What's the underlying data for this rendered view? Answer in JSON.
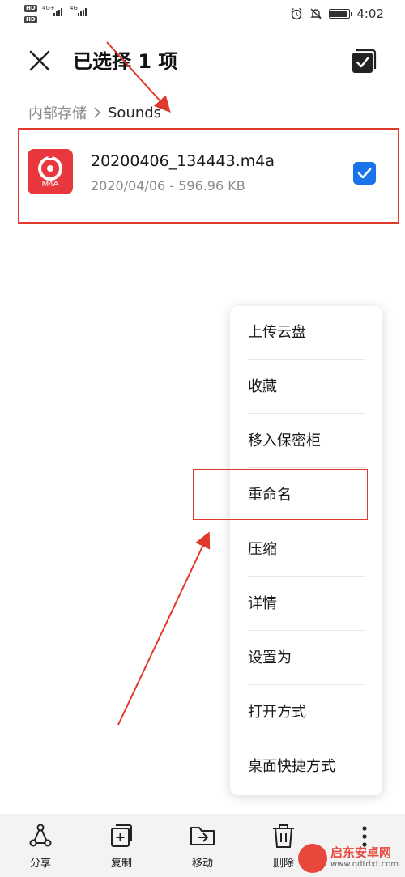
{
  "status_bar": {
    "left_badges": [
      "HD",
      "4G+",
      "4G",
      "HD"
    ],
    "time": "4:02",
    "battery_level": 0.85,
    "icons": [
      "alarm-icon",
      "mute-icon",
      "battery-icon"
    ]
  },
  "header": {
    "title": "已选择 1 项",
    "close_icon": "close-icon",
    "select_all_icon": "select-all-icon"
  },
  "breadcrumb": {
    "root": "内部存储",
    "separator": ">",
    "current": "Sounds"
  },
  "file": {
    "icon_label": "M4A",
    "name": "20200406_134443.m4a",
    "meta": "2020/04/06 - 596.96 KB",
    "checked": true
  },
  "menu": {
    "items": [
      {
        "label": "上传云盘"
      },
      {
        "label": "收藏"
      },
      {
        "label": "移入保密柜"
      },
      {
        "label": "重命名"
      },
      {
        "label": "压缩"
      },
      {
        "label": "详情"
      },
      {
        "label": "设置为"
      },
      {
        "label": "打开方式"
      },
      {
        "label": "桌面快捷方式"
      }
    ]
  },
  "toolbar": {
    "items": [
      {
        "label": "分享",
        "icon": "share-icon"
      },
      {
        "label": "复制",
        "icon": "copy-icon"
      },
      {
        "label": "移动",
        "icon": "move-icon"
      },
      {
        "label": "删除",
        "icon": "delete-icon"
      }
    ],
    "more_icon": "more-vertical-icon"
  },
  "watermark": {
    "name": "启东安卓网",
    "url": "www.qdtdxt.com"
  },
  "colors": {
    "accent_blue": "#1a73e8",
    "file_icon_red": "#e8383d",
    "annotation_red": "#e03a2f"
  }
}
